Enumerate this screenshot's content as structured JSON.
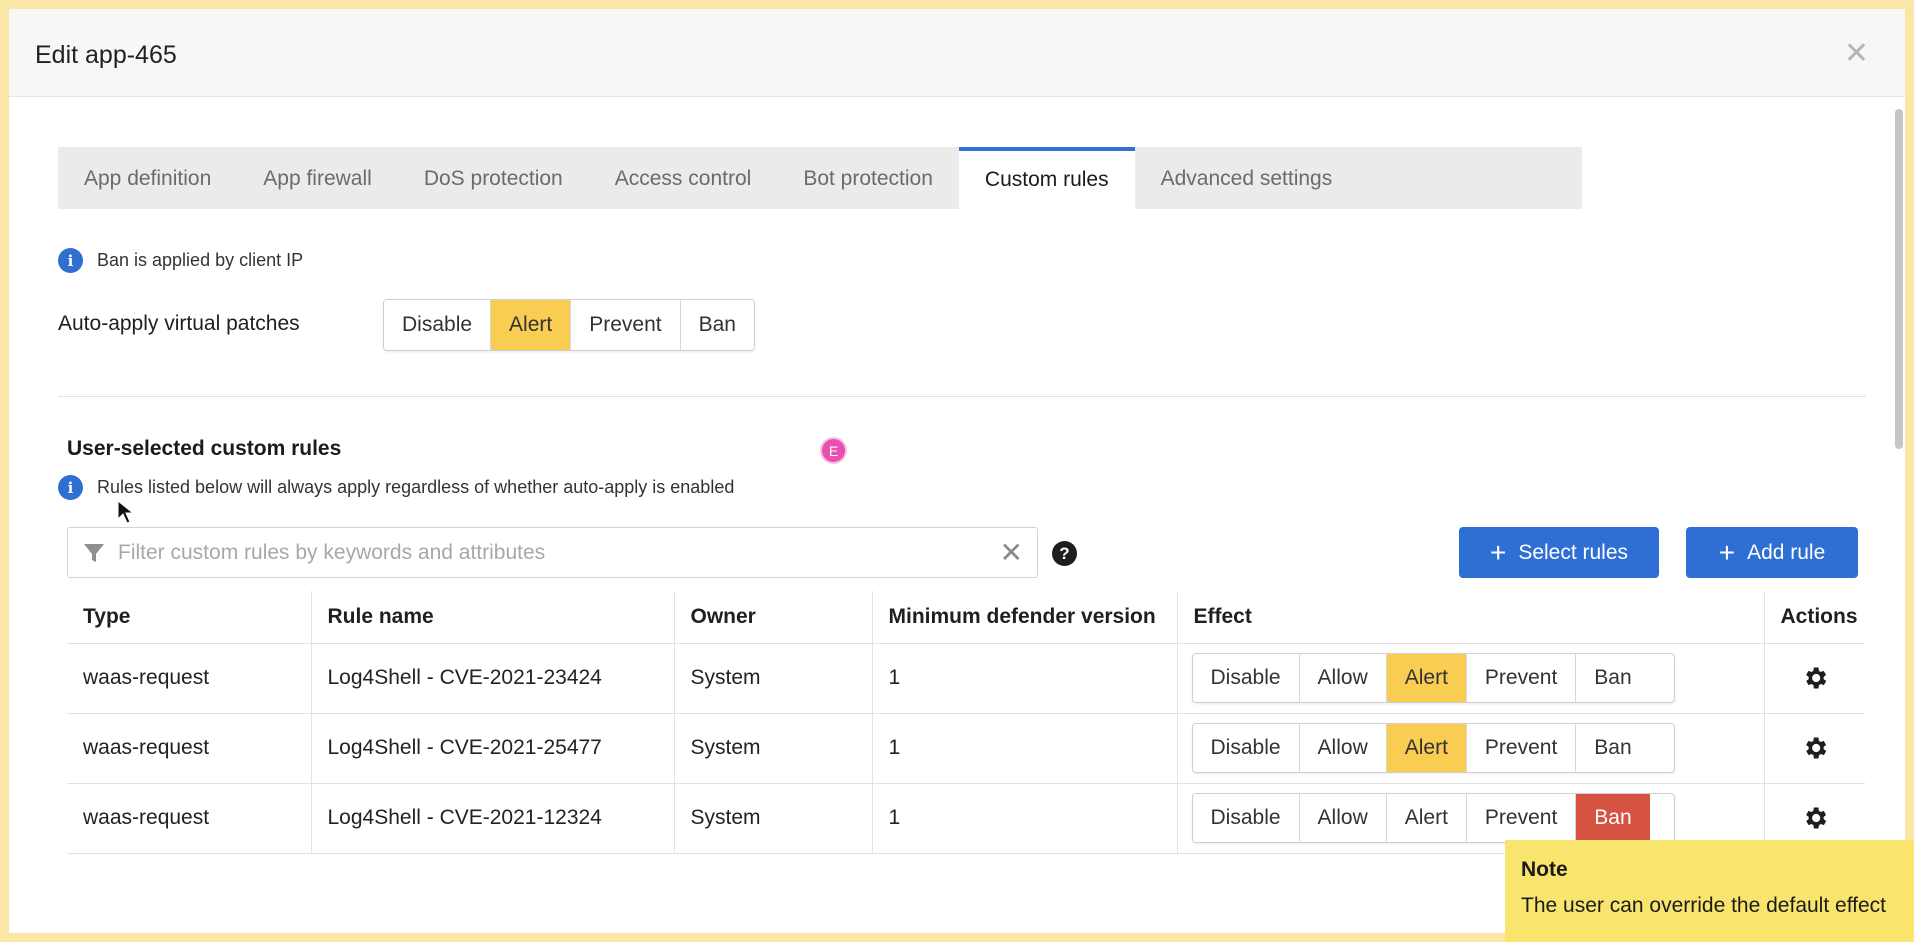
{
  "modal": {
    "title": "Edit app-465"
  },
  "tabs": [
    {
      "label": "App definition"
    },
    {
      "label": "App firewall"
    },
    {
      "label": "DoS protection"
    },
    {
      "label": "Access control"
    },
    {
      "label": "Bot protection"
    },
    {
      "label": "Custom rules",
      "active": true
    },
    {
      "label": "Advanced settings"
    }
  ],
  "ban_info": {
    "text": "Ban is applied by client IP",
    "icon": "info-icon"
  },
  "auto_apply": {
    "label": "Auto-apply virtual patches",
    "options": [
      "Disable",
      "Alert",
      "Prevent",
      "Ban"
    ],
    "selected": "Alert"
  },
  "custom_rules": {
    "title": "User-selected custom rules",
    "avatar_initial": "E",
    "info": "Rules listed below will always apply regardless of whether auto-apply is enabled",
    "filter_placeholder": "Filter custom rules by keywords and attributes",
    "select_rules_label": "Select rules",
    "add_rule_label": "Add rule"
  },
  "table": {
    "headers": [
      "Type",
      "Rule name",
      "Owner",
      "Minimum defender version",
      "Effect",
      "Actions"
    ],
    "effect_options": [
      "Disable",
      "Allow",
      "Alert",
      "Prevent",
      "Ban"
    ],
    "rows": [
      {
        "type": "waas-request",
        "rule_name": "Log4Shell - CVE-2021-23424",
        "owner": "System",
        "min_version": "1",
        "effect": "Alert"
      },
      {
        "type": "waas-request",
        "rule_name": "Log4Shell - CVE-2021-25477",
        "owner": "System",
        "min_version": "1",
        "effect": "Alert"
      },
      {
        "type": "waas-request",
        "rule_name": "Log4Shell - CVE-2021-12324",
        "owner": "System",
        "min_version": "1",
        "effect": "Ban"
      }
    ]
  },
  "note": {
    "title": "Note",
    "text": "The user can override the default effect"
  },
  "colors": {
    "accent": "#2e6fd3",
    "alert_selected": "#f8cd52",
    "ban_selected": "#d65241",
    "note_bg": "#f9e56e",
    "frame": "#f8e7a6"
  }
}
